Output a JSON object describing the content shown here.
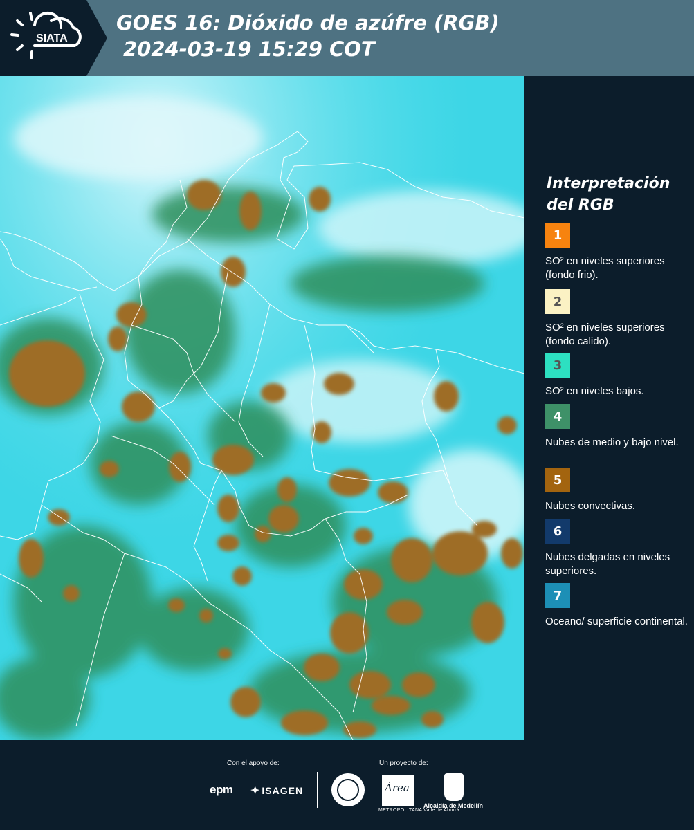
{
  "header": {
    "logo_text": "SIATA",
    "title_line1": "GOES 16: Dióxido de azúfre (RGB)",
    "title_line2": "2024-03-19 15:29 COT"
  },
  "legend": {
    "title_line1": "Interpretación",
    "title_line2": "del RGB",
    "items": [
      {
        "num": "1",
        "color": "#f7830f",
        "text_color": "#ffffff",
        "text": "SO² en niveles superiores (fondo frio)."
      },
      {
        "num": "2",
        "color": "#fbf2c4",
        "text_color": "#555555",
        "text": "SO² en niveles superiores (fondo calido)."
      },
      {
        "num": "3",
        "color": "#2de0c1",
        "text_color": "#555555",
        "text": "SO² en niveles bajos."
      },
      {
        "num": "4",
        "color": "#3e9168",
        "text_color": "#ffffff",
        "text": "Nubes de medio y bajo nivel."
      },
      {
        "num": "5",
        "color": "#a3640f",
        "text_color": "#ffffff",
        "text": "Nubes convectivas."
      },
      {
        "num": "6",
        "color": "#123a6b",
        "text_color": "#ffffff",
        "text": "Nubes delgadas en niveles superiores."
      },
      {
        "num": "7",
        "color": "#1d8fb6",
        "text_color": "#ffffff",
        "text": "Oceano/ superficie continental."
      }
    ]
  },
  "footer": {
    "support_label": "Con el apoyo de:",
    "project_label": "Un proyecto de:",
    "sponsor1": "epm",
    "sponsor2": "ISAGEN",
    "area_logo": "Área",
    "area_subtitle": "METROPOLITANA Valle de Aburrá",
    "alcaldia": "Alcaldía de Medellín"
  },
  "colors": {
    "header_bg": "#4e7282",
    "panel_bg": "#0c1d2b",
    "ocean": "#3fd9e8",
    "convective": "#9c6c25",
    "midlevel": "#3e9168"
  }
}
